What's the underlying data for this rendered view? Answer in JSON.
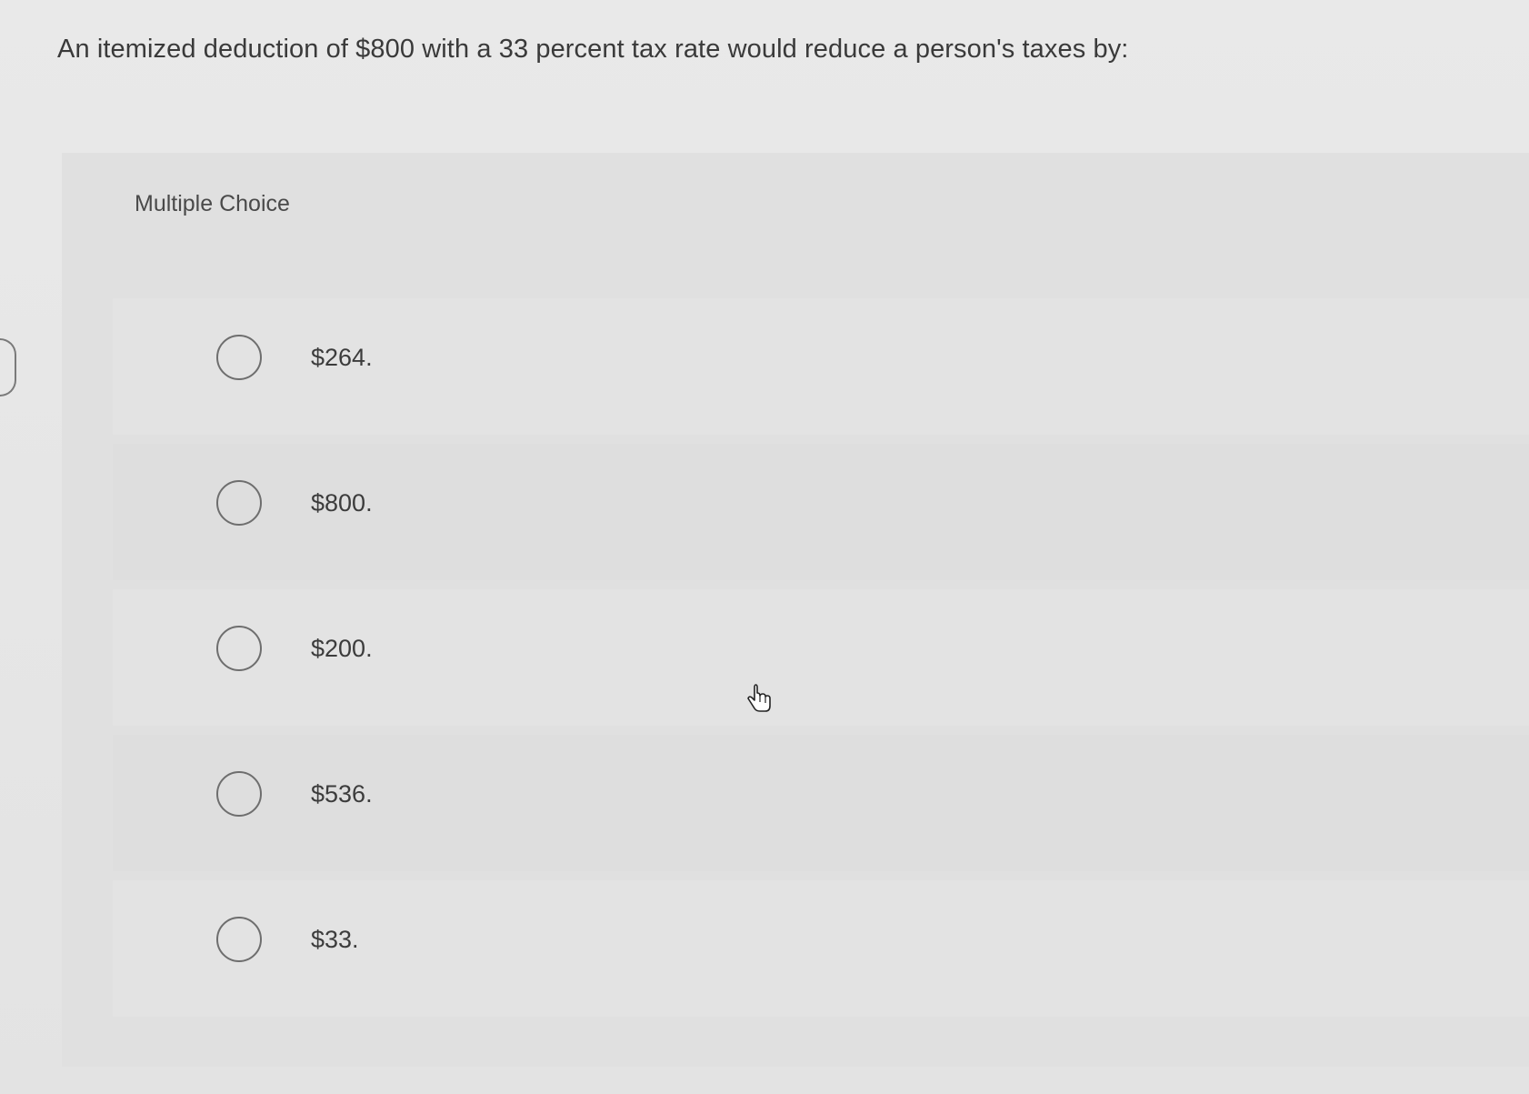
{
  "question": {
    "text": "An itemized deduction of $800 with a 33 percent tax rate would reduce a person's taxes by:"
  },
  "choices": {
    "title": "Multiple Choice",
    "options": [
      {
        "label": "$264."
      },
      {
        "label": "$800."
      },
      {
        "label": "$200."
      },
      {
        "label": "$536."
      },
      {
        "label": "$33."
      }
    ]
  },
  "icons": {
    "cursor": "hand-pointer-icon",
    "radio": "radio-button-unselected"
  }
}
